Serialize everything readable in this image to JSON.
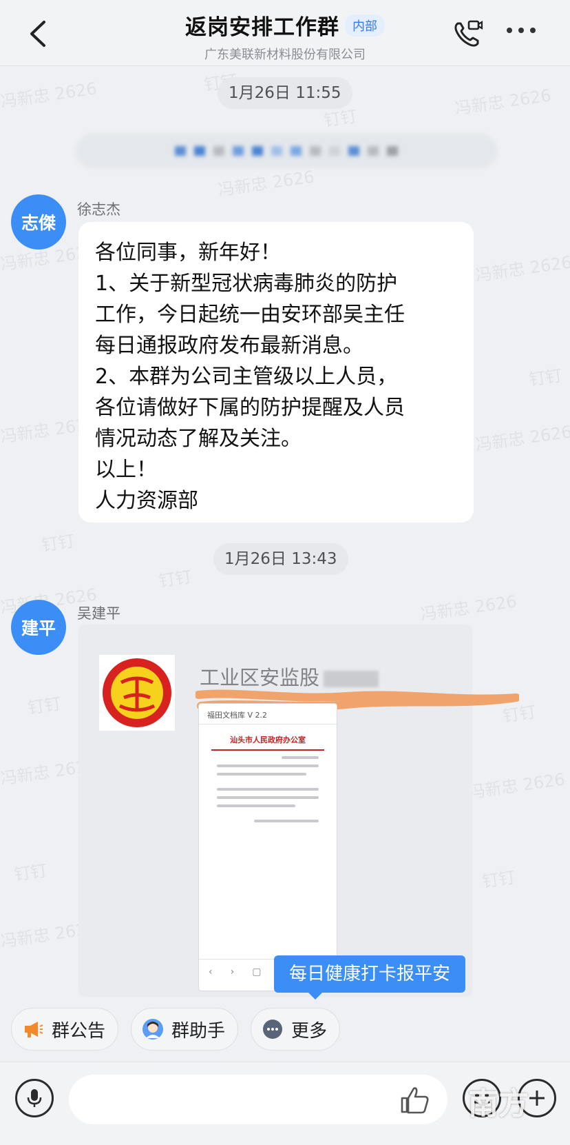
{
  "header": {
    "title": "返岗安排工作群",
    "tag": "内部",
    "subtitle": "广东美联新材料股份有限公司"
  },
  "watermark": {
    "name": "冯新忠 2626",
    "app": "钉钉"
  },
  "messages": {
    "time1": "1月26日 11:55",
    "sender1": {
      "name": "徐志杰",
      "avatar": "志傑"
    },
    "text_lines": [
      "各位同事，新年好！",
      "1、关于新型冠状病毒肺炎的防护",
      "工作，今日起统一由安环部吴主任",
      "每日通报政府发布最新消息。",
      "2、本群为公司主管级以上人员，",
      "各位请做好下属的防护提醒及人员",
      "情况动态了解及关注。",
      "以上！",
      "人力资源部"
    ],
    "time2": "1月26日 13:43",
    "sender2": {
      "name": "吴建平",
      "avatar": "建平"
    },
    "card": {
      "title": "工业区安监股",
      "doc_top": "福田文档库 V 2.2",
      "doc_heading": "汕头市人民政府办公室"
    }
  },
  "tooltip": "每日健康打卡报平安",
  "quick_actions": {
    "announcement": "群公告",
    "assistant": "群助手",
    "more": "更多"
  },
  "input": {
    "placeholder": ""
  },
  "corner_logo": "南方",
  "colors": {
    "accent": "#3a8ef6",
    "scribble": "#f0a36a"
  }
}
